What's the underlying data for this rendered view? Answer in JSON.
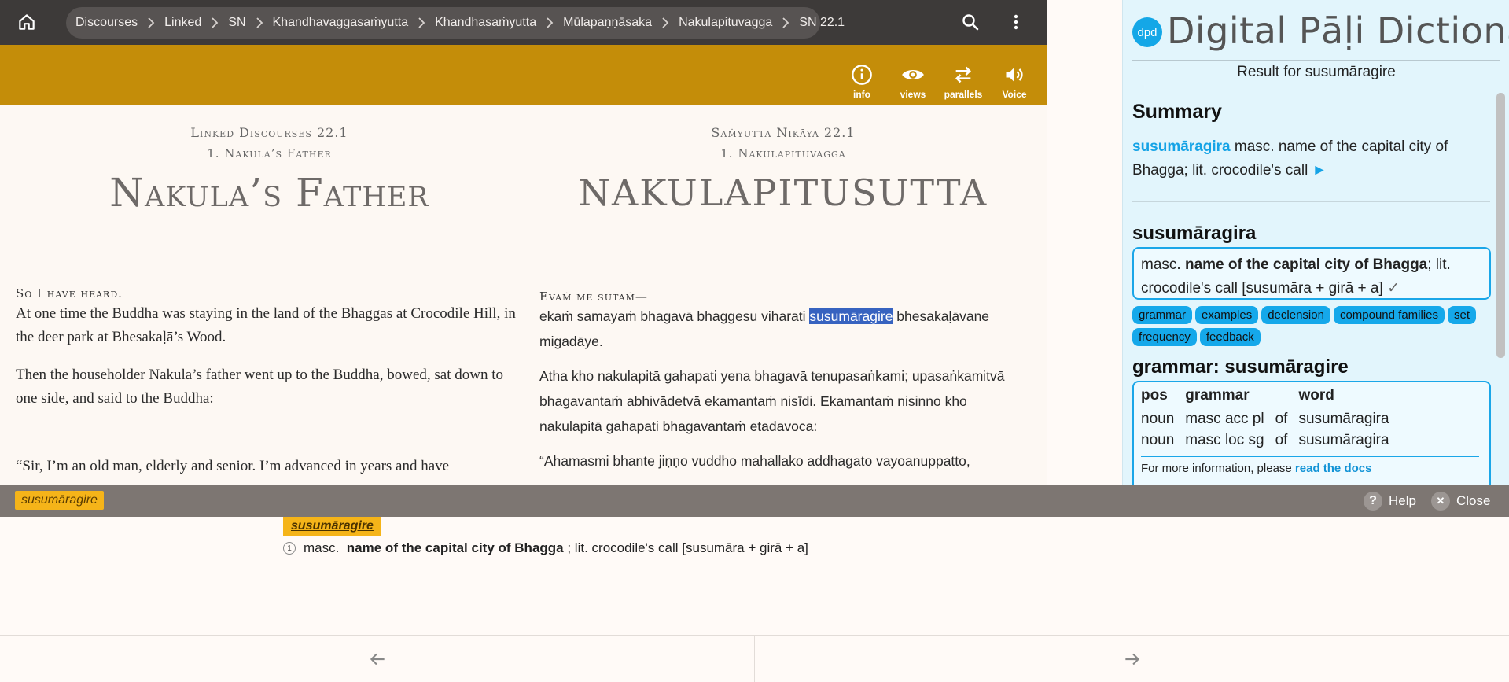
{
  "nav": {
    "breadcrumbs": [
      "Discourses",
      "Linked",
      "SN",
      "Khandhavaggasaṁyutta",
      "Khandhasaṁyutta",
      "Mūlapaṇṇāsaka",
      "Nakulapituvagga",
      "SN 22.1"
    ]
  },
  "toolbar": {
    "info_label": "info",
    "views_label": "views",
    "parallels_label": "parallels",
    "voice_label": "Voice"
  },
  "article": {
    "english": {
      "kicker": "Linked Discourses 22.1",
      "subkicker": "1. Nakula’s Father",
      "title": "Nakula’s Father",
      "opening": "So I have heard.",
      "p1": "At one time the Buddha was staying in the land of the Bhaggas at Crocodile Hill, in the deer park at Bhesakaḷā’s Wood.",
      "p2": "Then the householder Nakula’s father went up to the Buddha, bowed, sat down to one side, and said to the Buddha:",
      "p3": "“Sir, I’m an old man, elderly and senior. I’m advanced in years and have"
    },
    "pali": {
      "kicker": "Saṁyutta Nikāya 22.1",
      "subkicker": "1. Nakulapituvagga",
      "title": "Nakulapitusutta",
      "opening": "Evaṁ me sutaṁ—",
      "p1_before": "ekaṁ samayaṁ bhagavā bhaggesu viharati ",
      "p1_highlight": "susumāragire",
      "p1_after": " bhesakaḷāvane migadāye.",
      "p2": "Atha kho nakulapitā gahapati yena bhagavā tenupasaṅkami; upasaṅkamitvā bhagavantaṁ abhivādetvā ekamantaṁ nisīdi. Ekamantaṁ nisinno kho nakulapitā gahapati bhagavantaṁ etadavoca:",
      "p3": "“Ahamasmi bhante jiṇṇo vuddho mahallako addhagato vayoanuppatto,"
    }
  },
  "dpd": {
    "logo_text": "dpd",
    "brand": "Digital Pāḷi Dictionary",
    "result_for": "Result for susumāragire",
    "summary_heading": "Summary",
    "summary_word": "susumāragira",
    "summary_text": " masc. name of the capital city of Bhagga; lit. crocodile's call",
    "summary_play": "►",
    "headword": "susumāragira",
    "def_pos": "masc.",
    "def_bold": "name of the capital city of Bhagga",
    "def_rest": "; lit. crocodile's call [susumāra + girā + a]",
    "def_check": "✓",
    "buttons": [
      "grammar",
      "examples",
      "declension",
      "compound families",
      "set",
      "frequency",
      "feedback"
    ],
    "grammar_heading": "grammar: susumāragire",
    "grammar_cols": [
      "pos",
      "grammar",
      "",
      "word"
    ],
    "grammar_rows": [
      [
        "noun",
        "masc acc pl",
        "of",
        "susumāragira"
      ],
      [
        "noun",
        "masc loc sg",
        "of",
        "susumāragira"
      ]
    ],
    "more_info_prefix": "For more information, please ",
    "more_info_link": "read the docs"
  },
  "lookup": {
    "word": "susumāragire",
    "help_label": "Help",
    "close_label": "Close",
    "help_glyph": "?",
    "close_glyph": "✕"
  },
  "definition": {
    "word": "susumāragire",
    "num": "1",
    "pos": "masc.",
    "bold": "name of the capital city of Bhagga",
    "rest": "; lit. crocodile's call [susumāra + girā + a]"
  },
  "colors": {
    "topbar": "#3d3a39",
    "toolbar": "#c48d09",
    "dpd_accent": "#15a3e6",
    "highlight": "#3763c0",
    "lookup_chip": "#f5b419"
  },
  "icons": {
    "home": "home-icon",
    "search": "search-icon",
    "more": "more-vert-icon",
    "info": "info-icon",
    "views": "eye-icon",
    "parallels": "swap-icon",
    "voice": "speaker-icon",
    "prev": "arrow-left-icon",
    "next": "arrow-right-icon"
  }
}
